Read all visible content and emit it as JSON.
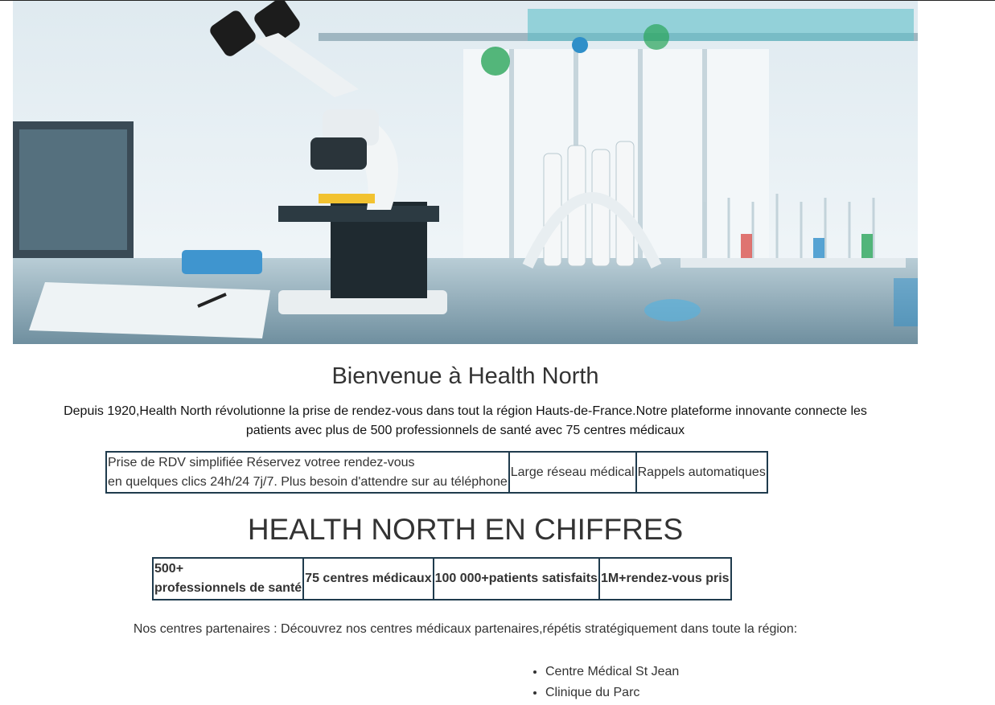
{
  "hero": {
    "image": "laboratory-microscope-photo",
    "colors": {
      "bench": "#8fb3c4",
      "sky": "#e6f1f6",
      "accent_blue": "#2f8fc9",
      "accent_green": "#2aa55a",
      "accent_red": "#d9534f"
    }
  },
  "welcome": {
    "title": "Bienvenue à Health North",
    "intro": "Depuis 1920,Health North révolutionne la prise de rendez-vous dans tout la région Hauts-de-France.Notre plateforme innovante connecte les patients avec plus de 500 professionnels de santé avec 75 centres médicaux"
  },
  "features": [
    {
      "title": "Prise de RDV simplifiée Réservez votree rendez-vous",
      "desc": "en quelques clics 24h/24 7j/7. Plus besoin d'attendre sur au téléphone"
    },
    {
      "title": "Large réseau médical"
    },
    {
      "title": "Rappels automatiques"
    }
  ],
  "stats": {
    "title": "HEALTH NORTH EN CHIFFRES",
    "items": [
      {
        "value": "500+",
        "label": "professionnels de santé"
      },
      {
        "text": "75 centres médicaux"
      },
      {
        "text": "100 000+patients satisfaits"
      },
      {
        "text": "1M+rendez-vous pris"
      }
    ]
  },
  "partners": {
    "text": "Nos centres partenaires : Découvrez nos centres médicaux partenaires,répétis stratégiquement dans toute la région:",
    "centers": [
      "Centre Médical St Jean",
      "Clinique du Parc"
    ]
  },
  "colors": {
    "table_border": "#1f3b4d",
    "text": "#333333"
  }
}
